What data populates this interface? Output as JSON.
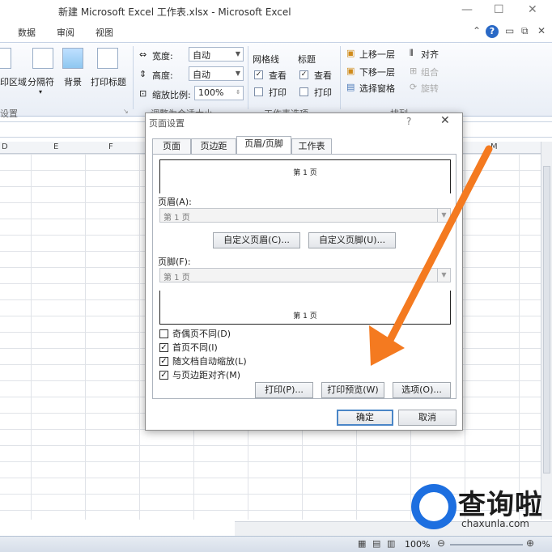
{
  "window": {
    "title": "新建 Microsoft Excel 工作表.xlsx - Microsoft Excel"
  },
  "ribbon_tabs": [
    "数据",
    "审阅",
    "视图"
  ],
  "ribbon": {
    "page_setup_buttons": [
      "印区域",
      "分隔符",
      "背景",
      "打印标题"
    ],
    "page_setup_caption": "设置",
    "scale": {
      "width_label": "宽度:",
      "width_value": "自动",
      "height_label": "高度:",
      "height_value": "自动",
      "zoom_label": "缩放比例:",
      "zoom_value": "100%",
      "caption": "调整为合适大小"
    },
    "sheet_options": {
      "gridlines_label": "网格线",
      "headings_label": "标题",
      "view_label": "查看",
      "print_label": "打印",
      "caption": "工作表选项"
    },
    "arrange": {
      "bring_forward": "上移一层",
      "send_backward": "下移一层",
      "selection_pane": "选择窗格",
      "align": "对齐",
      "group": "组合",
      "rotate": "旋转",
      "caption": "排列"
    }
  },
  "columns": [
    "D",
    "E",
    "F",
    "M"
  ],
  "dialog": {
    "title": "页面设置",
    "help": "?",
    "close": "✕",
    "tabs": [
      "页面",
      "页边距",
      "页眉/页脚",
      "工作表"
    ],
    "active_tab": "页眉/页脚",
    "header_preview_text": "第 1 页",
    "header_label": "页眉(A):",
    "header_value": "第 1 页",
    "custom_header_button": "自定义页眉(C)...",
    "custom_footer_button": "自定义页脚(U)...",
    "footer_label": "页脚(F):",
    "footer_value": "第 1 页",
    "footer_preview_text": "第 1 页",
    "checkboxes": [
      {
        "label": "奇偶页不同(D)",
        "checked": false
      },
      {
        "label": "首页不同(I)",
        "checked": true
      },
      {
        "label": "随文档自动缩放(L)",
        "checked": true
      },
      {
        "label": "与页边距对齐(M)",
        "checked": true
      }
    ],
    "print_button": "打印(P)...",
    "print_preview_button": "打印预览(W)",
    "options_button": "选项(O)...",
    "ok_button": "确定",
    "cancel_button": "取消"
  },
  "status": {
    "zoom": "100%"
  },
  "watermark": {
    "brand": "查询啦",
    "url": "chaxunla.com"
  },
  "colors": {
    "arrow": "#f47a20",
    "accent": "#2a69c6",
    "watermark_blue": "#1d6fe0"
  }
}
